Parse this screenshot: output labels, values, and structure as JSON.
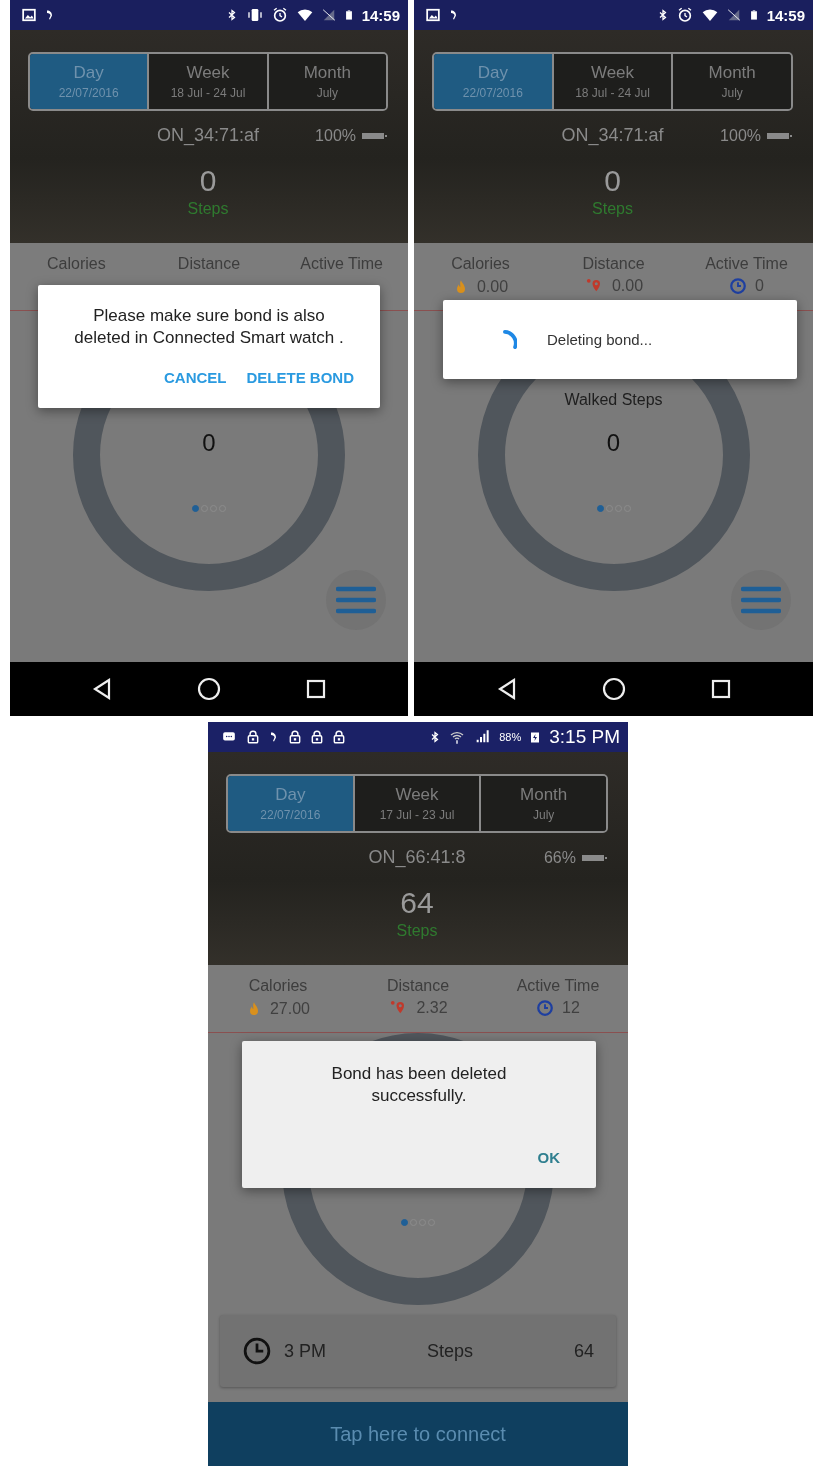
{
  "screens": [
    {
      "status_bar": {
        "kind": "stock",
        "vibrate": true,
        "time": "14:59"
      },
      "tabs": [
        {
          "label": "Day",
          "sub": "22/07/2016",
          "selected": true
        },
        {
          "label": "Week",
          "sub": "18 Jul - 24 Jul",
          "selected": false
        },
        {
          "label": "Month",
          "sub": "July",
          "selected": false
        }
      ],
      "device": {
        "name": "ON_34:71:af",
        "battery": "100%"
      },
      "steps": {
        "value": "0",
        "label": "Steps"
      },
      "stats": [
        {
          "label": "Calories"
        },
        {
          "label": "Distance"
        },
        {
          "label": "Active Time"
        }
      ],
      "ring": {
        "value": "0"
      },
      "pager": [
        {
          "selected": true
        },
        {
          "selected": false
        },
        {
          "selected": false
        },
        {
          "selected": false
        }
      ],
      "menu_button": true,
      "nav_bar": true,
      "dialog": {
        "kind": "confirm",
        "message": "Please make sure bond is also deleted in Connected Smart watch .",
        "buttons": [
          "CANCEL",
          "DELETE BOND"
        ]
      }
    },
    {
      "status_bar": {
        "kind": "stock",
        "vibrate": false,
        "time": "14:59"
      },
      "tabs": [
        {
          "label": "Day",
          "sub": "22/07/2016",
          "selected": true
        },
        {
          "label": "Week",
          "sub": "18 Jul - 24 Jul",
          "selected": false
        },
        {
          "label": "Month",
          "sub": "July",
          "selected": false
        }
      ],
      "device": {
        "name": "ON_34:71:af",
        "battery": "100%"
      },
      "steps": {
        "value": "0",
        "label": "Steps"
      },
      "stats": [
        {
          "kind": "calories",
          "label": "Calories",
          "value": "0.00"
        },
        {
          "kind": "distance",
          "label": "Distance",
          "value": "0.00"
        },
        {
          "kind": "active",
          "label": "Active Time",
          "value": "0"
        }
      ],
      "ring": {
        "title": "Walked Steps",
        "value": "0"
      },
      "pager": [
        {
          "selected": true
        },
        {
          "selected": false
        },
        {
          "selected": false
        },
        {
          "selected": false
        }
      ],
      "menu_button": true,
      "nav_bar": true,
      "dialog": {
        "kind": "progress",
        "message": "Deleting bond..."
      }
    },
    {
      "status_bar": {
        "kind": "samsung",
        "battery": "88%",
        "time": "3:15 PM"
      },
      "tabs": [
        {
          "label": "Day",
          "sub": "22/07/2016",
          "selected": true
        },
        {
          "label": "Week",
          "sub": "17 Jul - 23 Jul",
          "selected": false
        },
        {
          "label": "Month",
          "sub": "July",
          "selected": false
        }
      ],
      "device": {
        "name": "ON_66:41:8",
        "battery": "66%"
      },
      "steps": {
        "value": "64",
        "label": "Steps"
      },
      "stats": [
        {
          "kind": "calories",
          "label": "Calories",
          "value": "27.00"
        },
        {
          "kind": "distance",
          "label": "Distance",
          "value": "2.32"
        },
        {
          "kind": "active",
          "label": "Active Time",
          "value": "12"
        }
      ],
      "pager": [
        {
          "selected": true
        },
        {
          "selected": false
        },
        {
          "selected": false
        },
        {
          "selected": false
        }
      ],
      "hourly": {
        "time": "3 PM",
        "label": "Steps",
        "value": "64"
      },
      "connect_bar": "Tap here to connect",
      "dialog": {
        "kind": "alert",
        "message": "Bond has been deleted successfully.",
        "buttons": [
          "OK"
        ]
      }
    }
  ]
}
